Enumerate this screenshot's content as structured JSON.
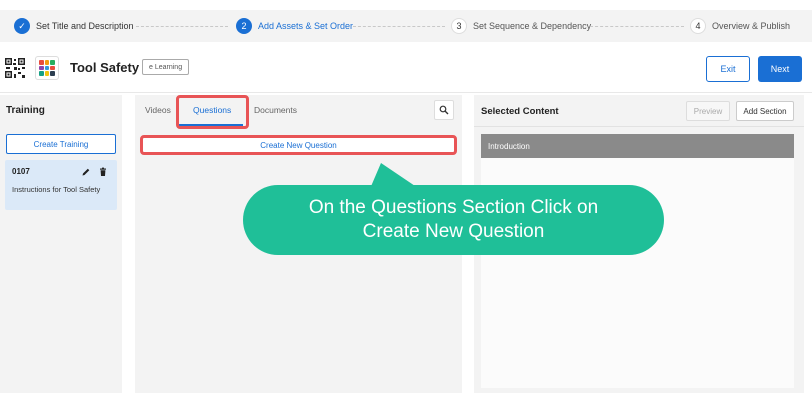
{
  "stepper": {
    "steps": [
      {
        "number": "✓",
        "label": "Set Title and Description"
      },
      {
        "number": "2",
        "label": "Add Assets & Set Order"
      },
      {
        "number": "3",
        "label": "Set Sequence & Dependency"
      },
      {
        "number": "4",
        "label": "Overview & Publish"
      }
    ],
    "active_color": "#1a6fd4"
  },
  "header": {
    "title": "Tool Safety",
    "type_tag": "e Learning",
    "exit_label": "Exit",
    "next_label": "Next"
  },
  "training_panel": {
    "title": "Training",
    "create_label": "Create Training",
    "card": {
      "code": "0107",
      "name": "Instructions for Tool Safety"
    }
  },
  "assets_panel": {
    "tabs": [
      {
        "label": "Videos"
      },
      {
        "label": "Questions"
      },
      {
        "label": "Documents"
      }
    ],
    "active_tab": "Questions",
    "create_question_label": "Create New Question",
    "search_icon": "search-icon"
  },
  "selected_panel": {
    "title": "Selected Content",
    "preview_label": "Preview",
    "add_section_label": "Add Section",
    "sections": [
      {
        "label": "Introduction"
      }
    ]
  },
  "callout": {
    "line1": "On the Questions Section Click on",
    "line2": "Create New Question",
    "color": "#1fbf98",
    "highlight_color": "#e85456"
  }
}
